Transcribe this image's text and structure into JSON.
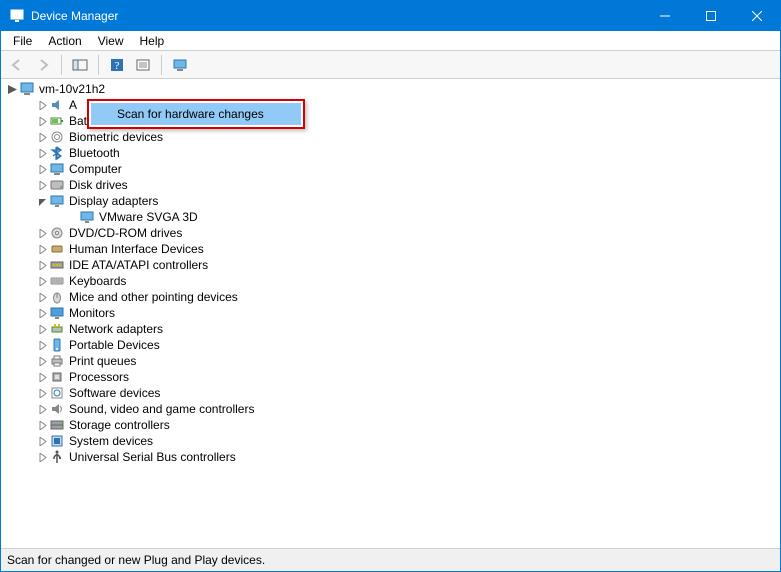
{
  "window": {
    "title": "Device Manager"
  },
  "menu": {
    "file": "File",
    "action": "Action",
    "view": "View",
    "help": "Help"
  },
  "tree": {
    "root": "vm-10v21h2",
    "items": [
      {
        "label": "A",
        "icon": "audio-icon"
      },
      {
        "label": "Batteries",
        "icon": "battery-icon"
      },
      {
        "label": "Biometric devices",
        "icon": "biometric-icon"
      },
      {
        "label": "Bluetooth",
        "icon": "bluetooth-icon"
      },
      {
        "label": "Computer",
        "icon": "computer-icon"
      },
      {
        "label": "Disk drives",
        "icon": "disk-icon"
      },
      {
        "label": "Display adapters",
        "icon": "display-icon",
        "expanded": true,
        "children": [
          {
            "label": "VMware SVGA 3D",
            "icon": "display-icon"
          }
        ]
      },
      {
        "label": "DVD/CD-ROM drives",
        "icon": "cdrom-icon"
      },
      {
        "label": "Human Interface Devices",
        "icon": "hid-icon"
      },
      {
        "label": "IDE ATA/ATAPI controllers",
        "icon": "ide-icon"
      },
      {
        "label": "Keyboards",
        "icon": "keyboard-icon"
      },
      {
        "label": "Mice and other pointing devices",
        "icon": "mouse-icon"
      },
      {
        "label": "Monitors",
        "icon": "monitor-icon"
      },
      {
        "label": "Network adapters",
        "icon": "network-icon"
      },
      {
        "label": "Portable Devices",
        "icon": "portable-icon"
      },
      {
        "label": "Print queues",
        "icon": "printer-icon"
      },
      {
        "label": "Processors",
        "icon": "cpu-icon"
      },
      {
        "label": "Software devices",
        "icon": "software-icon"
      },
      {
        "label": "Sound, video and game controllers",
        "icon": "sound-icon"
      },
      {
        "label": "Storage controllers",
        "icon": "storage-icon"
      },
      {
        "label": "System devices",
        "icon": "system-icon"
      },
      {
        "label": "Universal Serial Bus controllers",
        "icon": "usb-icon"
      }
    ]
  },
  "context_menu": {
    "scan": "Scan for hardware changes"
  },
  "statusbar": {
    "text": "Scan for changed or new Plug and Play devices."
  }
}
